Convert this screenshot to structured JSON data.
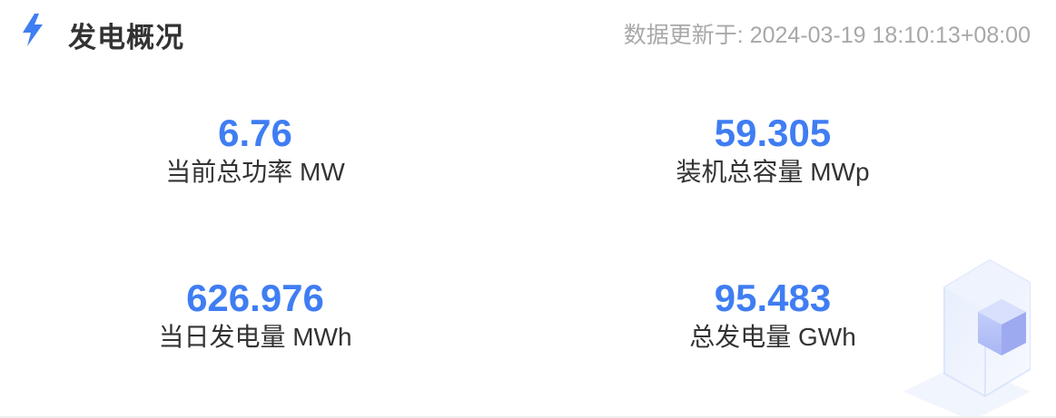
{
  "header": {
    "title": "发电概况",
    "updated_text": "数据更新于: 2024-03-19 18:10:13+08:00"
  },
  "stats": [
    {
      "value": "6.76",
      "label": "当前总功率 MW"
    },
    {
      "value": "59.305",
      "label": "装机总容量 MWp"
    },
    {
      "value": "626.976",
      "label": "当日发电量 MWh"
    },
    {
      "value": "95.483",
      "label": "总发电量 GWh"
    }
  ],
  "icons": {
    "header_icon": "lightning-bolt-icon",
    "decoration": "cube-decoration"
  },
  "colors": {
    "accent": "#3f7df3",
    "title": "#333333",
    "muted": "#a8a8a8"
  }
}
